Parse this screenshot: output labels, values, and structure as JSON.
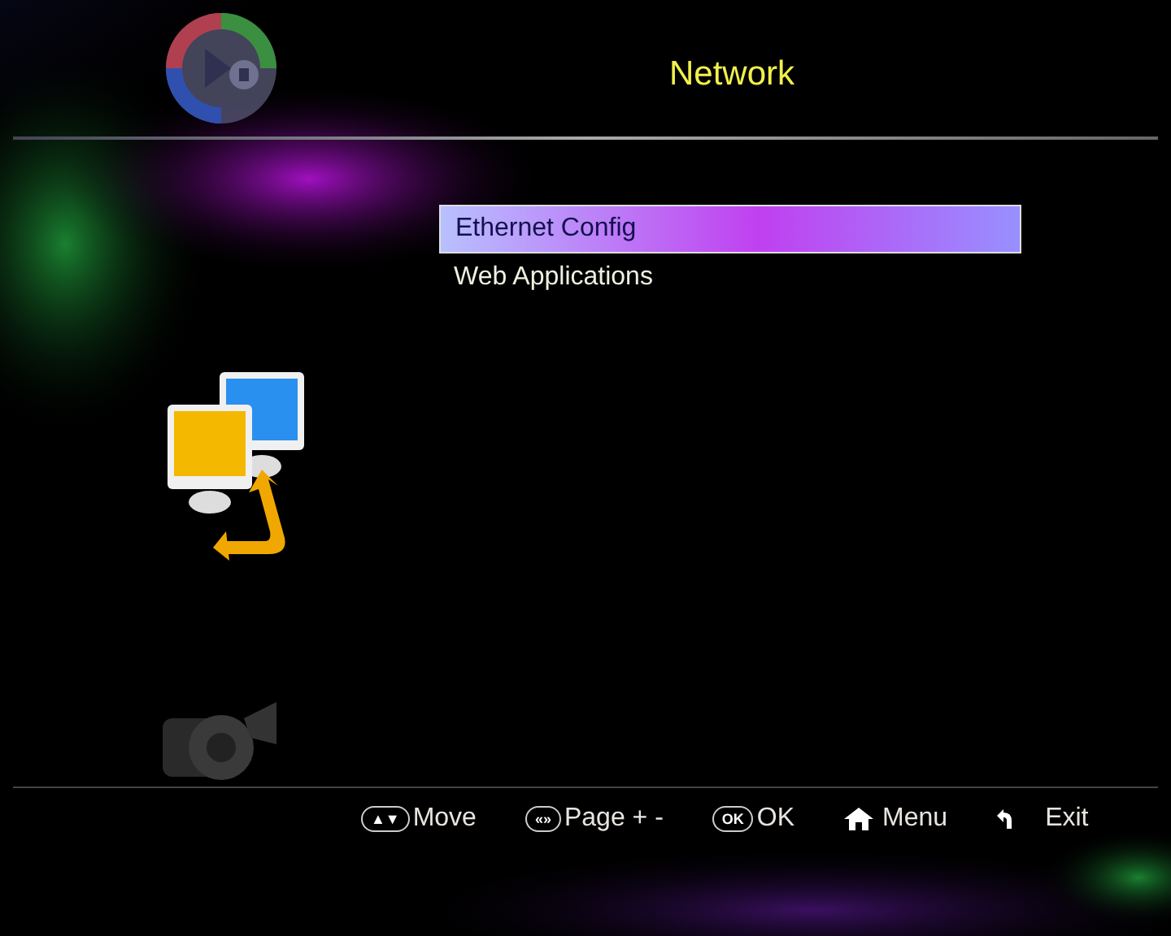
{
  "title": "Network",
  "menu": [
    {
      "label": "Ethernet Config",
      "selected": true
    },
    {
      "label": "Web Applications",
      "selected": false
    }
  ],
  "hints": [
    {
      "kind": "key",
      "key": "▲▼",
      "label": "Move"
    },
    {
      "kind": "key",
      "key": "«»",
      "label": "Page + -"
    },
    {
      "kind": "key",
      "key": "OK",
      "label": "OK"
    },
    {
      "kind": "home",
      "label": "Menu"
    },
    {
      "kind": "back",
      "label": "Exit"
    }
  ]
}
